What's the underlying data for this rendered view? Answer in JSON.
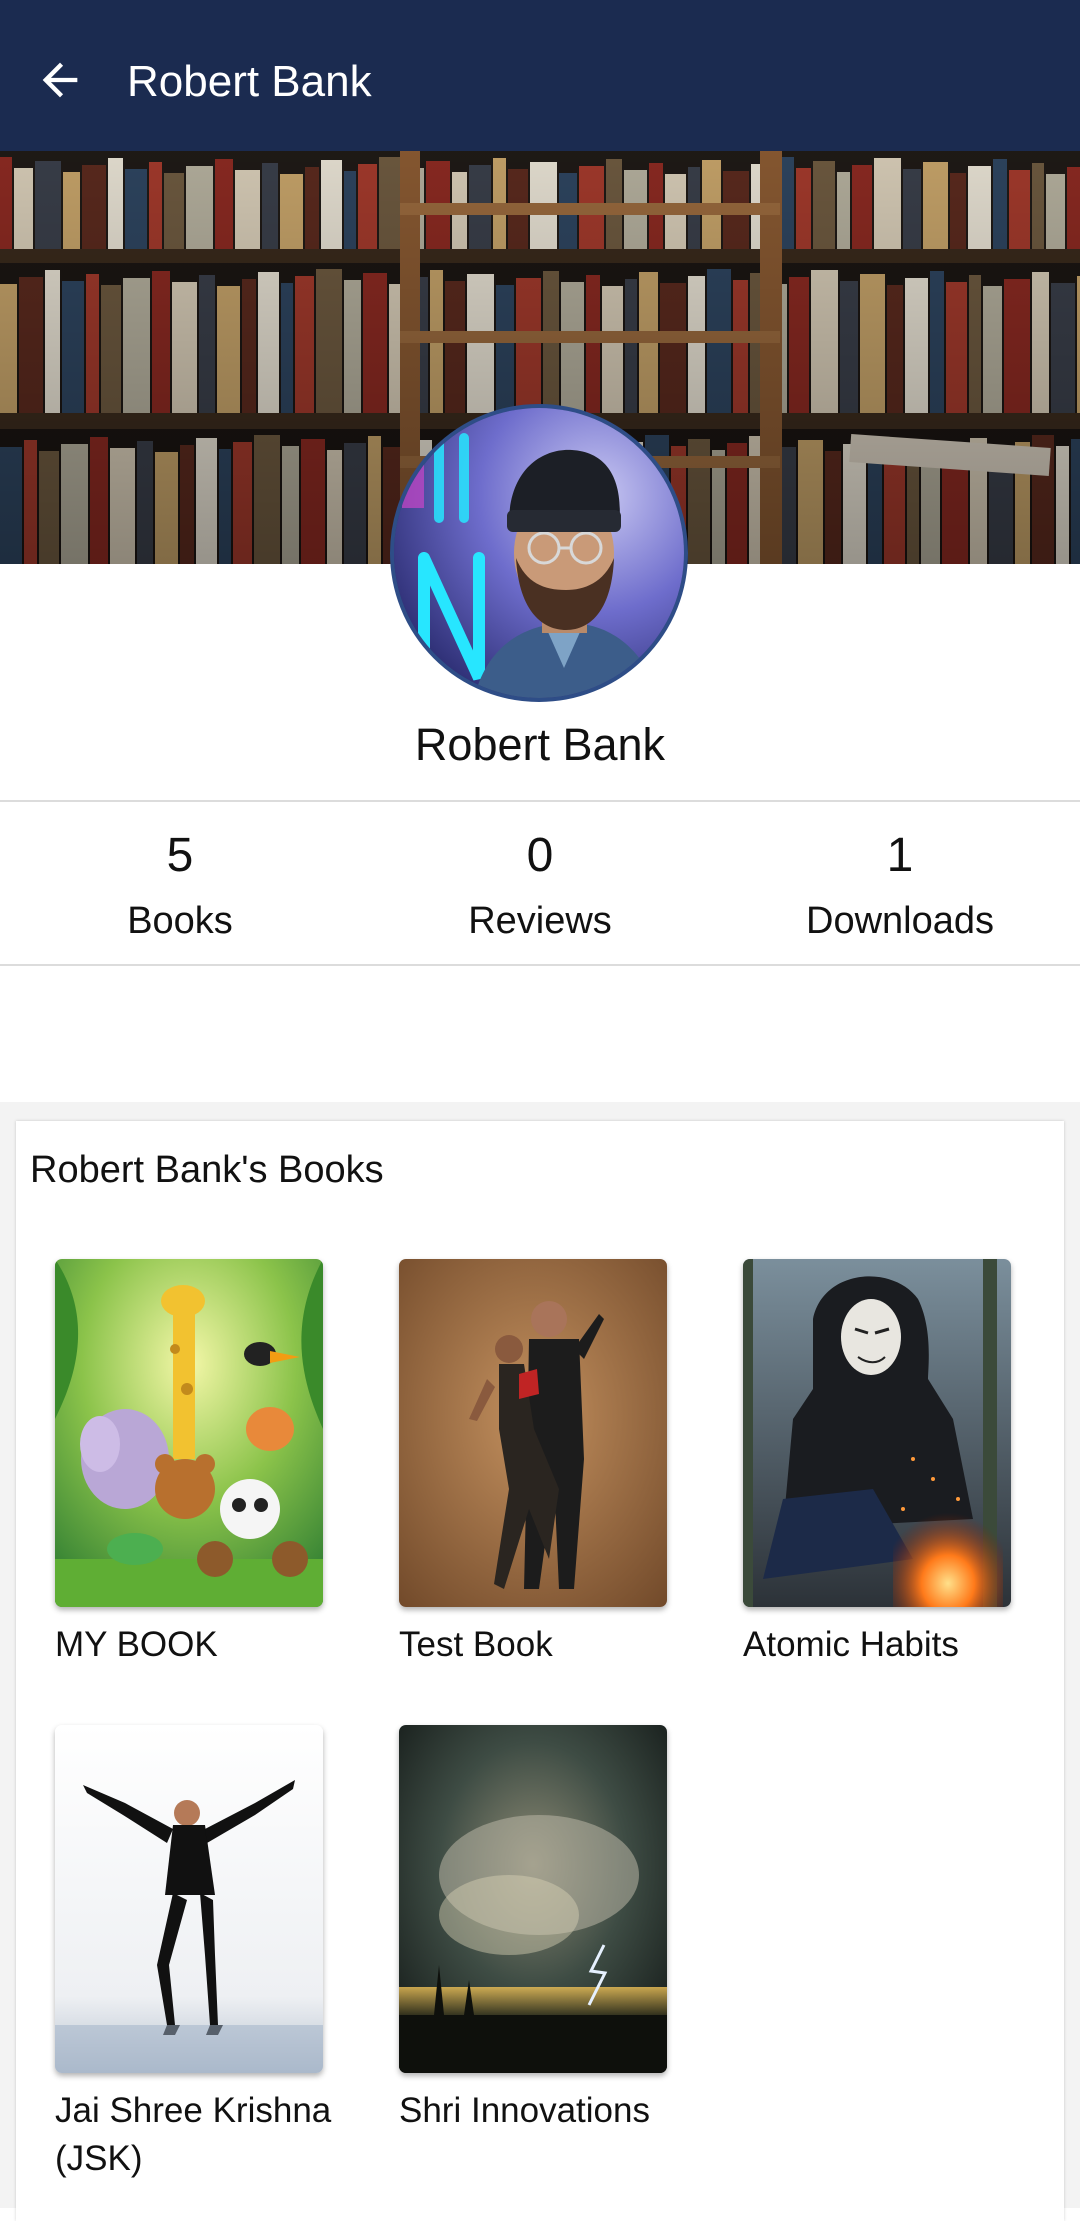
{
  "appbar": {
    "title": "Robert Bank",
    "back_icon": "arrow-left-icon",
    "background": "#1b2b50"
  },
  "profile": {
    "name": "Robert Bank"
  },
  "stats": [
    {
      "value": "5",
      "label": "Books"
    },
    {
      "value": "0",
      "label": "Reviews"
    },
    {
      "value": "1",
      "label": "Downloads"
    }
  ],
  "books_section": {
    "title": "Robert Bank's Books",
    "books": [
      {
        "title": "MY BOOK"
      },
      {
        "title": "Test Book"
      },
      {
        "title": "Atomic Habits"
      },
      {
        "title": "Jai Shree Krishna (JSK)"
      },
      {
        "title": "Shri Innovations"
      }
    ]
  }
}
